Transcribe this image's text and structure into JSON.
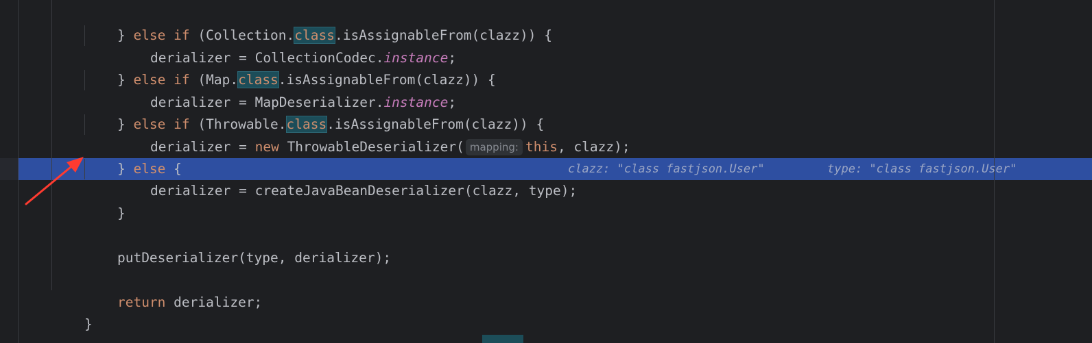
{
  "editor": {
    "lines": [
      {
        "id": "l1",
        "parts": [
          [
            "t",
            "} "
          ],
          [
            "kw",
            "else if"
          ],
          [
            "t",
            " (Collection."
          ],
          [
            "hl",
            "class"
          ],
          [
            "t",
            ".isAssignableFrom(clazz)) {"
          ]
        ]
      },
      {
        "id": "l2",
        "parts": [
          [
            "t",
            "derializer = CollectionCodec."
          ],
          [
            "st",
            "instance"
          ],
          [
            "t",
            ";"
          ]
        ]
      },
      {
        "id": "l3",
        "parts": [
          [
            "t",
            "} "
          ],
          [
            "kw",
            "else if"
          ],
          [
            "t",
            " (Map."
          ],
          [
            "hl",
            "class"
          ],
          [
            "t",
            ".isAssignableFrom(clazz)) {"
          ]
        ]
      },
      {
        "id": "l4",
        "parts": [
          [
            "t",
            "derializer = MapDeserializer."
          ],
          [
            "st",
            "instance"
          ],
          [
            "t",
            ";"
          ]
        ]
      },
      {
        "id": "l5",
        "parts": [
          [
            "t",
            "} "
          ],
          [
            "kw",
            "else if"
          ],
          [
            "t",
            " (Throwable."
          ],
          [
            "hl",
            "class"
          ],
          [
            "t",
            ".isAssignableFrom(clazz)) {"
          ]
        ]
      },
      {
        "id": "l6",
        "parts": [
          [
            "t",
            "derializer = "
          ],
          [
            "kw",
            "new"
          ],
          [
            "t",
            " ThrowableDeserializer("
          ],
          [
            "hint",
            "mapping:"
          ],
          [
            "kw",
            "this"
          ],
          [
            "t",
            ", clazz);"
          ]
        ]
      },
      {
        "id": "l7",
        "parts": [
          [
            "t",
            "} "
          ],
          [
            "kw",
            "else"
          ],
          [
            "t",
            " {"
          ]
        ]
      },
      {
        "id": "l8",
        "parts": [
          [
            "t",
            "derializer = createJavaBeanDeserializer(clazz, type);"
          ]
        ]
      },
      {
        "id": "l9",
        "parts": [
          [
            "t",
            "}"
          ]
        ]
      },
      {
        "id": "l10",
        "parts": [
          [
            "t",
            "putDeserializer(type, derializer);"
          ]
        ]
      },
      {
        "id": "l11",
        "parts": [
          [
            "kw",
            "return"
          ],
          [
            "t",
            " derializer;"
          ]
        ]
      },
      {
        "id": "l12",
        "parts": [
          [
            "t",
            "}"
          ]
        ]
      }
    ],
    "debug_values": {
      "clazz": "clazz: \"class fastjson.User\"",
      "type": "type: \"class fastjson.User\""
    },
    "colors": {
      "background": "#1e1f22",
      "execution_line": "#2e4fa1",
      "keyword": "#cf8e6d",
      "static_field": "#c77dbb",
      "class_highlight": "#1c4d59",
      "annotation_arrow": "#ff3b30"
    },
    "annotation": "red-arrow-pointing-at-current-line"
  }
}
